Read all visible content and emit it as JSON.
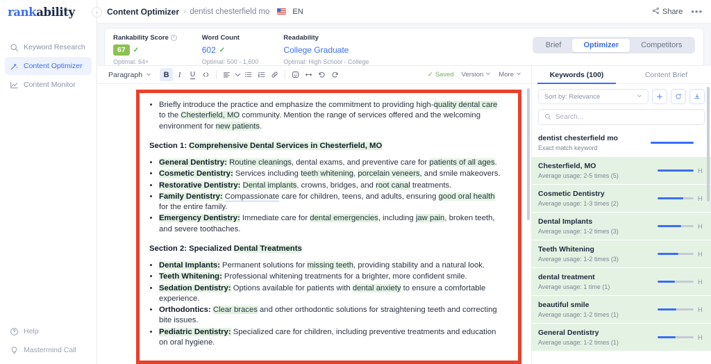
{
  "brand": {
    "part1": "rank",
    "part2": "ability"
  },
  "sidebar": {
    "items": [
      {
        "label": "Keyword Research",
        "icon": "search-icon",
        "active": false
      },
      {
        "label": "Content Optimizer",
        "icon": "magic-wand-icon",
        "active": true
      },
      {
        "label": "Content Monitor",
        "icon": "chart-line-icon",
        "active": false
      }
    ],
    "bottom": [
      {
        "label": "Help",
        "icon": "question-circle-icon"
      },
      {
        "label": "Mastermind Call",
        "icon": "lightbulb-icon"
      }
    ]
  },
  "topbar": {
    "breadcrumb_main": "Content Optimizer",
    "breadcrumb_sep": "›",
    "breadcrumb_sub": "dentist chesterfield mo",
    "language": "EN",
    "share_label": "Share",
    "more_label": "•••"
  },
  "stats": [
    {
      "label": "Rankability Score",
      "value": "67",
      "sub": "Optimal: 64+",
      "has_info": true,
      "checked": true,
      "style": "badge"
    },
    {
      "label": "Word Count",
      "value": "602",
      "sub": "Optimal: 500 - 1,600",
      "has_info": false,
      "checked": true,
      "style": "blue"
    },
    {
      "label": "Readability",
      "value": "College Graduate",
      "sub": "Optimal: High School - College",
      "has_info": false,
      "checked": false,
      "style": "blue"
    }
  ],
  "segmented": {
    "options": [
      "Brief",
      "Optimizer",
      "Competitors"
    ],
    "selected": "Optimizer"
  },
  "editor_toolbar": {
    "paragraph_label": "Paragraph",
    "buttons": [
      {
        "name": "bold-button",
        "glyph": "B",
        "active": true
      },
      {
        "name": "italic-button",
        "glyph": "I",
        "active": false
      },
      {
        "name": "underline-button",
        "glyph": "U",
        "active": false
      },
      {
        "name": "code-button",
        "glyph": "</>",
        "active": false
      }
    ],
    "saved_label": "Saved",
    "version_label": "Version",
    "more_label": "More"
  },
  "document": {
    "intro_bullet": [
      {
        "t": "Briefly introduce the practice and emphasize the commitment to providing high-"
      },
      {
        "t": "quality dental care",
        "hl": "green"
      },
      {
        "t": " to the "
      },
      {
        "t": "Chesterfield, MO",
        "hl": "green"
      },
      {
        "t": " community. Mention the range of services offered and the welcoming environment for "
      },
      {
        "t": "new patients",
        "hl": "green"
      },
      {
        "t": "."
      }
    ],
    "section1_prefix": "Section 1: ",
    "section1_highlight": "Comprehensive Dental Services in Chesterfield, MO",
    "section1_items": [
      {
        "term": "General Dentistry:",
        "term_hl": true,
        "parts": [
          {
            "t": " "
          },
          {
            "t": "Routine cleanings",
            "hl": "green"
          },
          {
            "t": ", dental exams, and preventive care for "
          },
          {
            "t": "patients of all ages",
            "hl": "green"
          },
          {
            "t": "."
          }
        ]
      },
      {
        "term": "Cosmetic Dentistry:",
        "term_hl": true,
        "parts": [
          {
            "t": " Services including "
          },
          {
            "t": "teeth whitening",
            "hl": "green"
          },
          {
            "t": ", "
          },
          {
            "t": "porcelain veneers",
            "hl": "green"
          },
          {
            "t": ", and smile makeovers."
          }
        ]
      },
      {
        "term": "Restorative Dentistry:",
        "term_hl": true,
        "parts": [
          {
            "t": " "
          },
          {
            "t": "Dental implants",
            "hl": "green"
          },
          {
            "t": ", crowns, bridges, and "
          },
          {
            "t": "root canal",
            "hl": "green"
          },
          {
            "t": " treatments."
          }
        ]
      },
      {
        "term": "Family Dentistry:",
        "term_hl": true,
        "parts": [
          {
            "t": " "
          },
          {
            "t": "Compassionate",
            "hl": "blue-u"
          },
          {
            "t": " care for children, teens, and adults, ensuring "
          },
          {
            "t": "good oral health",
            "hl": "green"
          },
          {
            "t": " for the entire family."
          }
        ]
      },
      {
        "term": "Emergency Dentistry:",
        "term_hl": true,
        "parts": [
          {
            "t": " Immediate care for "
          },
          {
            "t": "dental emergencies",
            "hl": "green"
          },
          {
            "t": ", including "
          },
          {
            "t": "jaw pain",
            "hl": "green"
          },
          {
            "t": ", broken teeth, and severe toothaches."
          }
        ]
      }
    ],
    "section2_prefix": "Section 2: Specialized ",
    "section2_highlight": "Dental Treatments",
    "section2_items": [
      {
        "term": "Dental Implants:",
        "term_hl": true,
        "parts": [
          {
            "t": " Permanent solutions for "
          },
          {
            "t": "missing teeth",
            "hl": "green"
          },
          {
            "t": ", providing stability and a natural look."
          }
        ]
      },
      {
        "term": "Teeth Whitening:",
        "term_hl": true,
        "parts": [
          {
            "t": " Professional whitening treatments for a brighter, more confident smile."
          }
        ]
      },
      {
        "term": "Sedation Dentistry:",
        "term_hl": true,
        "parts": [
          {
            "t": " Options available for patients with "
          },
          {
            "t": "dental anxiety",
            "hl": "green"
          },
          {
            "t": " to ensure a comfortable experience."
          }
        ]
      },
      {
        "term": "Orthodontics:",
        "term_hl": false,
        "parts": [
          {
            "t": " "
          },
          {
            "t": "Clear braces",
            "hl": "green"
          },
          {
            "t": " and other orthodontic solutions for straightening teeth and correcting bite issues."
          }
        ]
      },
      {
        "term": "Pediatric Dentistry:",
        "term_hl": true,
        "parts": [
          {
            "t": " Specialized care for children, including preventive treatments and education on oral hygiene."
          }
        ]
      }
    ]
  },
  "keywords_panel": {
    "tabs": [
      {
        "label": "Keywords (100)",
        "active": true
      },
      {
        "label": "Content Brief",
        "active": false
      }
    ],
    "sort_label": "Sort by: Relevance",
    "actions": [
      {
        "name": "add-keyword-button",
        "icon": "plus-icon"
      },
      {
        "name": "refresh-keywords-button",
        "icon": "refresh-icon"
      },
      {
        "name": "download-keywords-button",
        "icon": "download-icon"
      }
    ],
    "search_placeholder": "Search...",
    "search_value": "",
    "items": [
      {
        "name": "dentist chesterfield mo",
        "sub": "Exact match keyword",
        "fill": 100,
        "grade": "",
        "green": false,
        "full": true
      },
      {
        "name": "Chesterfield, MO",
        "sub": "Average usage: 2-5 times (5)",
        "fill": 100,
        "grade": "H",
        "green": true
      },
      {
        "name": "Cosmetic Dentistry",
        "sub": "Average usage: 1-3 times (2)",
        "fill": 72,
        "grade": "H",
        "green": true
      },
      {
        "name": "Dental Implants",
        "sub": "Average usage: 1-2 times (3)",
        "fill": 66,
        "grade": "H",
        "green": true
      },
      {
        "name": "Teeth Whitening",
        "sub": "Average usage: 1-2 times (3)",
        "fill": 58,
        "grade": "H",
        "green": true
      },
      {
        "name": "dental treatment",
        "sub": "Average usage: 1 time (1)",
        "fill": 48,
        "grade": "H",
        "green": true
      },
      {
        "name": "beautiful smile",
        "sub": "Average usage: 1-2 times (1)",
        "fill": 52,
        "grade": "H",
        "green": true
      },
      {
        "name": "General Dentistry",
        "sub": "Average usage: 1-2 times (1)",
        "fill": 50,
        "grade": "H",
        "green": true
      }
    ]
  },
  "colors": {
    "accent": "#3b6ef3",
    "score_badge": "#8cc152",
    "doc_border": "#e8412a",
    "keyword_highlight": "#e3f3e3",
    "keyword_row_green": "#e4f2e4"
  }
}
